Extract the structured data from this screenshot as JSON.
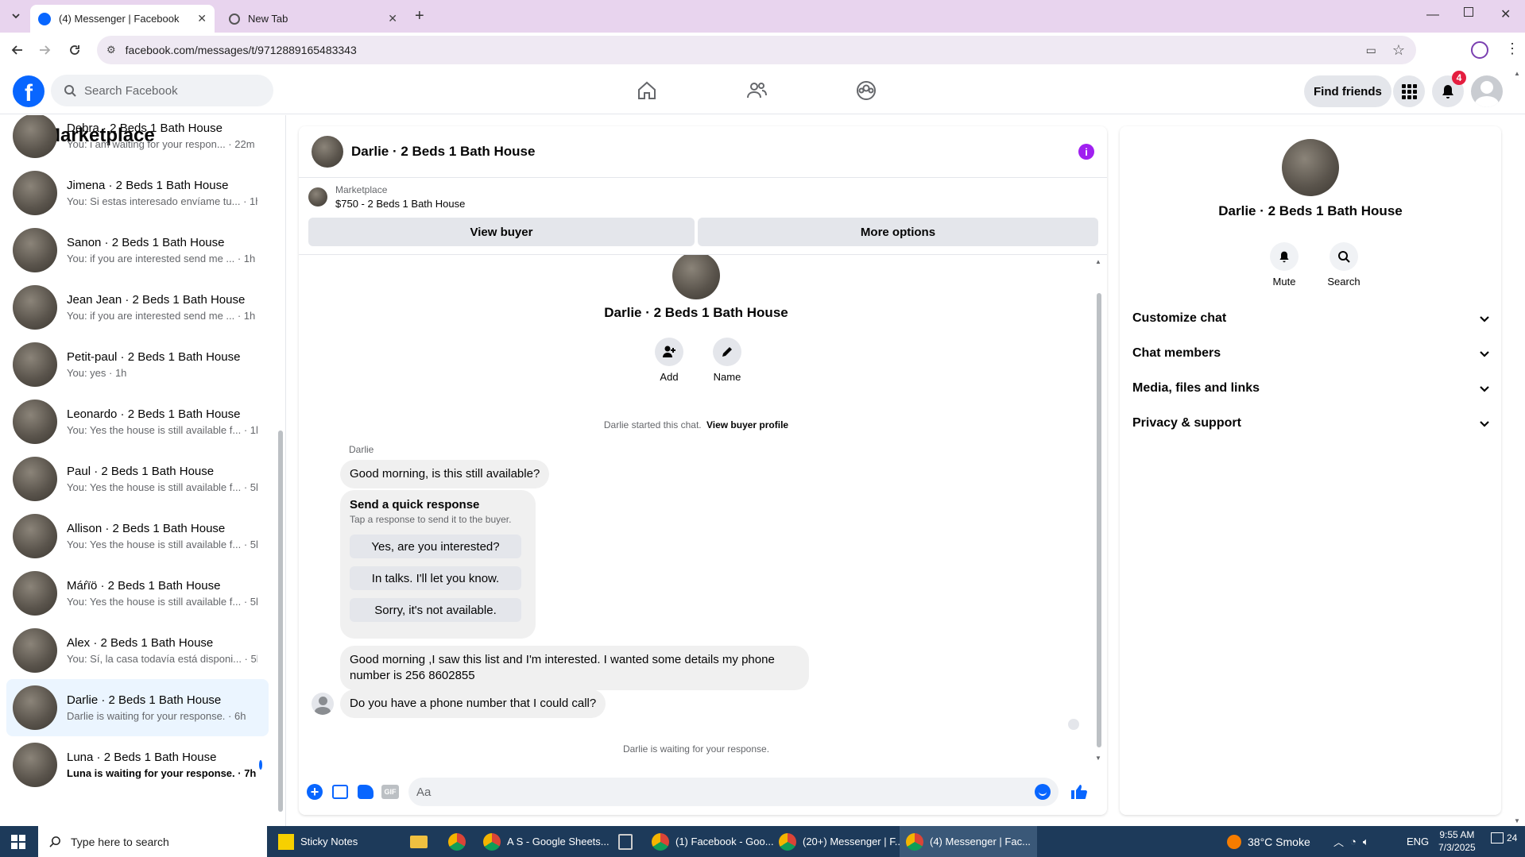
{
  "browser": {
    "tabs": [
      {
        "title": "(4) Messenger | Facebook",
        "active": true
      },
      {
        "title": "New Tab",
        "active": false
      }
    ],
    "url": "facebook.com/messages/t/9712889165483343"
  },
  "header": {
    "search_placeholder": "Search Facebook",
    "find_friends": "Find friends",
    "notif_count": "4"
  },
  "sidebar": {
    "title": "Marketplace",
    "conversations": [
      {
        "name": "Debra · 2 Beds 1 Bath House",
        "preview": "You: i am waiting for your respon... · 22m",
        "unread": false,
        "selected": false
      },
      {
        "name": "Jimena · 2 Beds 1 Bath House",
        "preview": "You: Si estas interesado envíame tu... · 1h",
        "unread": false,
        "selected": false
      },
      {
        "name": "Sanon · 2 Beds 1 Bath House",
        "preview": "You: if you are interested send me ... · 1h",
        "unread": false,
        "selected": false
      },
      {
        "name": "Jean Jean · 2 Beds 1 Bath House",
        "preview": "You: if you are interested send me ... · 1h",
        "unread": false,
        "selected": false
      },
      {
        "name": "Petit-paul · 2 Beds 1 Bath House",
        "preview": "You: yes · 1h",
        "unread": false,
        "selected": false
      },
      {
        "name": "Leonardo · 2 Beds 1 Bath House",
        "preview": "You: Yes the house is still available f... · 1h",
        "unread": false,
        "selected": false
      },
      {
        "name": "Paul · 2 Beds 1 Bath House",
        "preview": "You: Yes the house is still available f... · 5h",
        "unread": false,
        "selected": false
      },
      {
        "name": "Allison · 2 Beds 1 Bath House",
        "preview": "You: Yes the house is still available f... · 5h",
        "unread": false,
        "selected": false
      },
      {
        "name": "Máŕïö · 2 Beds 1 Bath House",
        "preview": "You: Yes the house is still available f... · 5h",
        "unread": false,
        "selected": false
      },
      {
        "name": "Alex · 2 Beds 1 Bath House",
        "preview": "You: Sí, la casa todavía está disponi... · 5h",
        "unread": false,
        "selected": false
      },
      {
        "name": "Darlie · 2 Beds 1 Bath House",
        "preview": "Darlie is waiting for your response. · 6h",
        "unread": false,
        "selected": true
      },
      {
        "name": "Luna · 2 Beds 1 Bath House",
        "preview": "Luna is waiting for your response. · 7h",
        "unread": true,
        "selected": false
      }
    ]
  },
  "chat": {
    "title": "Darlie · 2 Beds 1 Bath House",
    "listing_source": "Marketplace",
    "listing_title": "$750 - 2 Beds 1 Bath House",
    "view_buyer": "View buyer",
    "more_options": "More options",
    "intro_name": "Darlie · 2 Beds 1 Bath House",
    "add_label": "Add",
    "name_label": "Name",
    "started_text": "Darlie started this chat.",
    "view_buyer_profile": "View buyer profile",
    "sender_name": "Darlie",
    "msg1": "Good morning, is this still available?",
    "quick_title": "Send a quick response",
    "quick_sub": "Tap a response to send it to the buyer.",
    "quick_responses": [
      "Yes, are you interested?",
      "In talks. I'll let you know.",
      "Sorry, it's not available."
    ],
    "msg2": "Good morning ,I saw this list and I'm interested. I wanted some details my phone number is 256 8602855",
    "msg3": "Do you have a phone number that I could call?",
    "waiting": "Darlie is waiting for your response.",
    "composer_placeholder": "Aa"
  },
  "details": {
    "name": "Darlie · 2 Beds 1 Bath House",
    "mute": "Mute",
    "search": "Search",
    "sections": [
      "Customize chat",
      "Chat members",
      "Media, files and links",
      "Privacy & support"
    ]
  },
  "taskbar": {
    "search_placeholder": "Type here to search",
    "apps": [
      "Sticky Notes",
      "A S - Google Sheets...",
      "(1) Facebook - Goo...",
      "(20+) Messenger | F...",
      "(4) Messenger | Fac..."
    ],
    "weather": "38°C  Smoke",
    "lang": "ENG",
    "time": "9:55 AM",
    "date": "7/3/2025",
    "notif": "24"
  },
  "colors": {
    "fb_blue": "#0866ff",
    "selected_bg": "#ebf5ff",
    "badge_red": "#e41e3f",
    "info_purple": "#a020f0"
  }
}
